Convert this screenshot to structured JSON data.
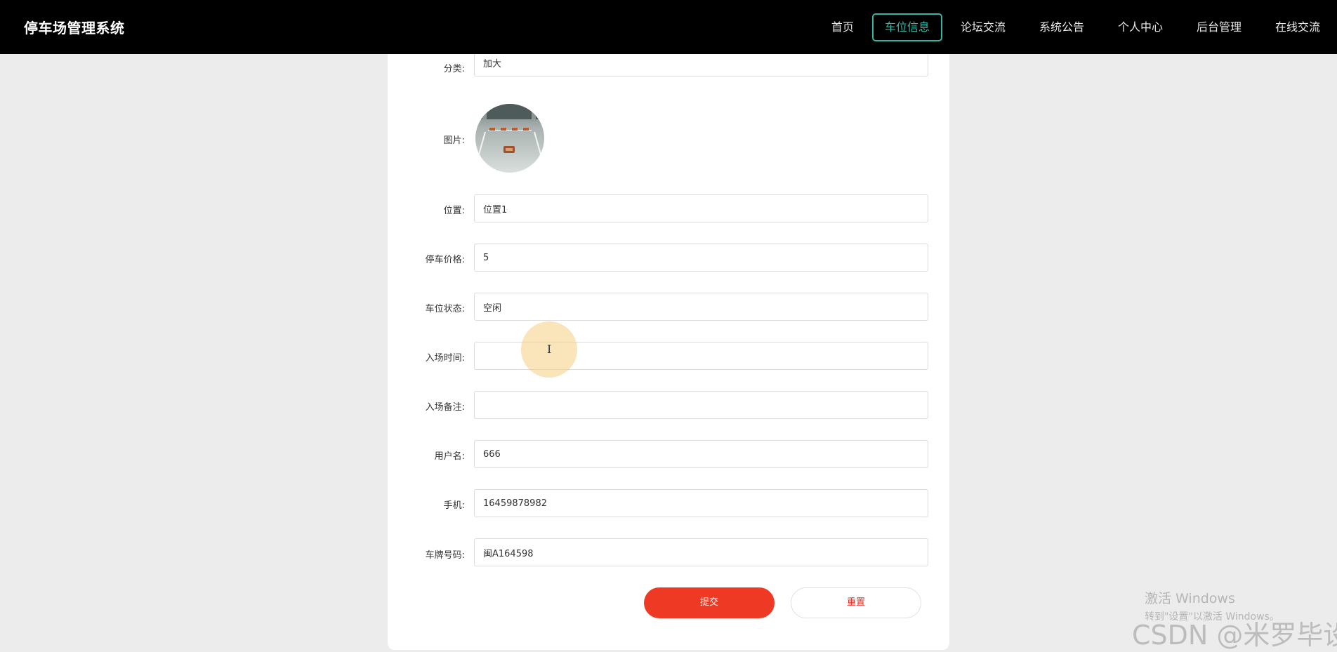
{
  "header": {
    "brand": "停车场管理系统",
    "nav": [
      {
        "label": "首页",
        "active": false
      },
      {
        "label": "车位信息",
        "active": true
      },
      {
        "label": "论坛交流",
        "active": false
      },
      {
        "label": "系统公告",
        "active": false
      },
      {
        "label": "个人中心",
        "active": false
      },
      {
        "label": "后台管理",
        "active": false
      },
      {
        "label": "在线交流",
        "active": false
      }
    ],
    "accent_color": "#33b5a5"
  },
  "form": {
    "category": {
      "label": "分类:",
      "value": "加大"
    },
    "image": {
      "label": "图片:"
    },
    "location": {
      "label": "位置:",
      "value": "位置1"
    },
    "price": {
      "label": "停车价格:",
      "value": "5"
    },
    "status": {
      "label": "车位状态:",
      "value": "空闲"
    },
    "entry_time": {
      "label": "入场时间:",
      "value": ""
    },
    "entry_note": {
      "label": "入场备注:",
      "value": ""
    },
    "username": {
      "label": "用户名:",
      "value": "666"
    },
    "phone": {
      "label": "手机:",
      "value": "16459878982"
    },
    "plate": {
      "label": "车牌号码:",
      "value": "闽A164598"
    },
    "submit_label": "提交",
    "reset_label": "重置",
    "submit_color": "#ee3a24"
  },
  "watermark": {
    "windows_line1": "激活 Windows",
    "windows_line2": "转到\"设置\"以激活 Windows。",
    "csdn": "CSDN @米罗毕设"
  }
}
